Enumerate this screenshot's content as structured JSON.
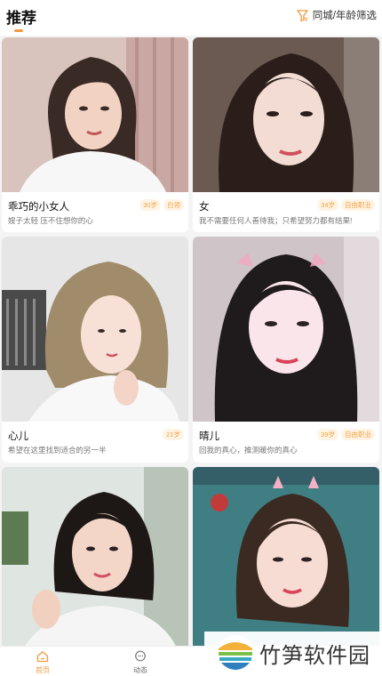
{
  "header": {
    "title": "推荐",
    "filter_label": "同城/年龄筛选"
  },
  "colors": {
    "accent": "#f39a3f",
    "tag_text": "#f0a548",
    "tag_bg": "#fff3e4"
  },
  "cards": [
    {
      "name": "乖巧的小女人",
      "tags": [
        "30岁",
        "白领"
      ],
      "bio": "嫂子太轻 压不住想你的心"
    },
    {
      "name": "女",
      "tags": [
        "34岁",
        "自由职业"
      ],
      "bio": "我不需要任何人善待我；只希望努力都有结果!"
    },
    {
      "name": "心儿",
      "tags": [
        "21岁"
      ],
      "bio": "希望在这里找到适合的另一半"
    },
    {
      "name": "晴儿",
      "tags": [
        "39岁",
        "自由职业"
      ],
      "bio": "回我的真心，推测暖你的真心"
    },
    {
      "name": "",
      "tags": [],
      "bio": ""
    },
    {
      "name": "",
      "tags": [],
      "bio": ""
    }
  ],
  "tabbar": {
    "items": [
      {
        "label": "首页",
        "icon": "home-icon",
        "active": true
      },
      {
        "label": "动态",
        "icon": "chat-bubble-icon",
        "active": false
      }
    ]
  },
  "watermark": {
    "text": "竹笋软件园",
    "logo": "bamboo-logo"
  }
}
